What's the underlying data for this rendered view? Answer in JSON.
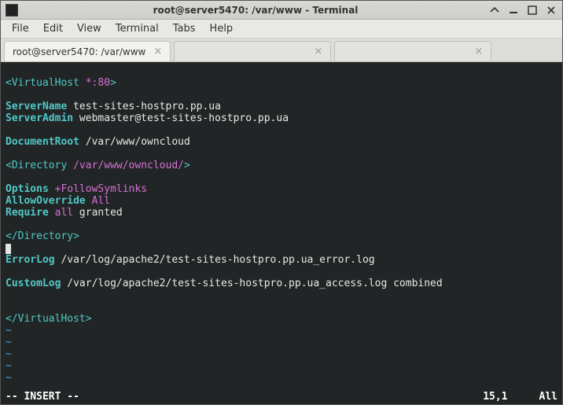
{
  "window": {
    "title": "root@server5470: /var/www - Terminal"
  },
  "menubar": [
    "File",
    "Edit",
    "View",
    "Terminal",
    "Tabs",
    "Help"
  ],
  "tabs": [
    {
      "label": "root@server5470: /var/www",
      "active": true
    },
    {
      "label": " ",
      "active": false
    },
    {
      "label": " ",
      "active": false
    }
  ],
  "config": {
    "vhost_open": "<VirtualHost",
    "vhost_port": " *:80",
    "vhost_open_close": ">",
    "server_name_k": "ServerName",
    "server_name_v": " test-sites-hostpro.pp.ua",
    "server_admin_k": "ServerAdmin",
    "server_admin_v": " webmaster@test-sites-hostpro.pp.ua",
    "docroot_k": "DocumentRoot",
    "docroot_v": " /var/www/owncloud",
    "dir_open": "<Directory",
    "dir_path": " /var/www/owncloud/",
    "dir_open_close": ">",
    "options_k": "Options",
    "options_v": " +FollowSymlinks",
    "allowoverride_k": "AllowOverride",
    "allowoverride_v": " All",
    "require_k": "Require",
    "require_v1": " all",
    "require_v2": " granted",
    "dir_close": "</Directory>",
    "errorlog_k": "ErrorLog",
    "errorlog_v": " /var/log/apache2/test-sites-hostpro.pp.ua_error.log",
    "customlog_k": "CustomLog",
    "customlog_v": " /var/log/apache2/test-sites-hostpro.pp.ua_access.log combined",
    "vhost_close": "</VirtualHost>"
  },
  "tilde": "~",
  "status": {
    "mode": "-- INSERT --",
    "position": "15,1",
    "scroll": "All"
  }
}
